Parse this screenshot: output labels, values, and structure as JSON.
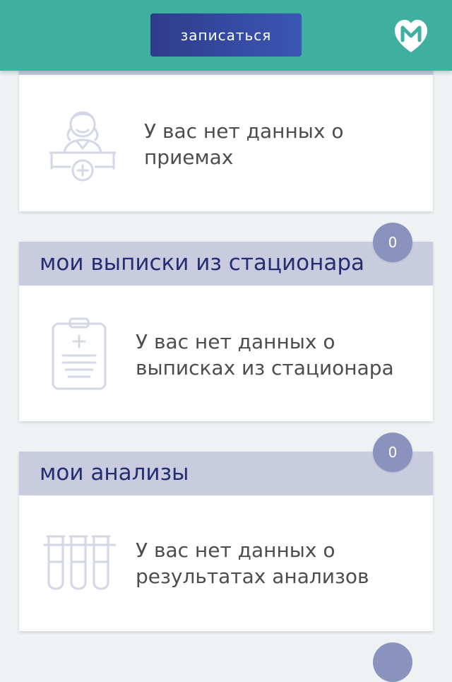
{
  "header": {
    "book_button_label": "записаться",
    "logo_icon": "heart-m-logo-icon",
    "background_color": "#3fb0a0",
    "button_color": "#2e3c8a"
  },
  "sections": [
    {
      "title": "",
      "count": "",
      "icon": "doctor-desk-icon",
      "empty_text": "У вас нет данных о приемах"
    },
    {
      "title": "мои выписки из стационара",
      "count": "0",
      "icon": "clipboard-icon",
      "empty_text": "У вас нет данных о выписках из стационара"
    },
    {
      "title": "мои анализы",
      "count": "0",
      "icon": "test-tubes-icon",
      "empty_text": "У вас нет данных о результатах анализов"
    }
  ],
  "colors": {
    "card_header": "#c9ccdf",
    "title_text": "#262d73",
    "badge": "#8a93bd",
    "icon_stroke": "#d3d7e6"
  }
}
